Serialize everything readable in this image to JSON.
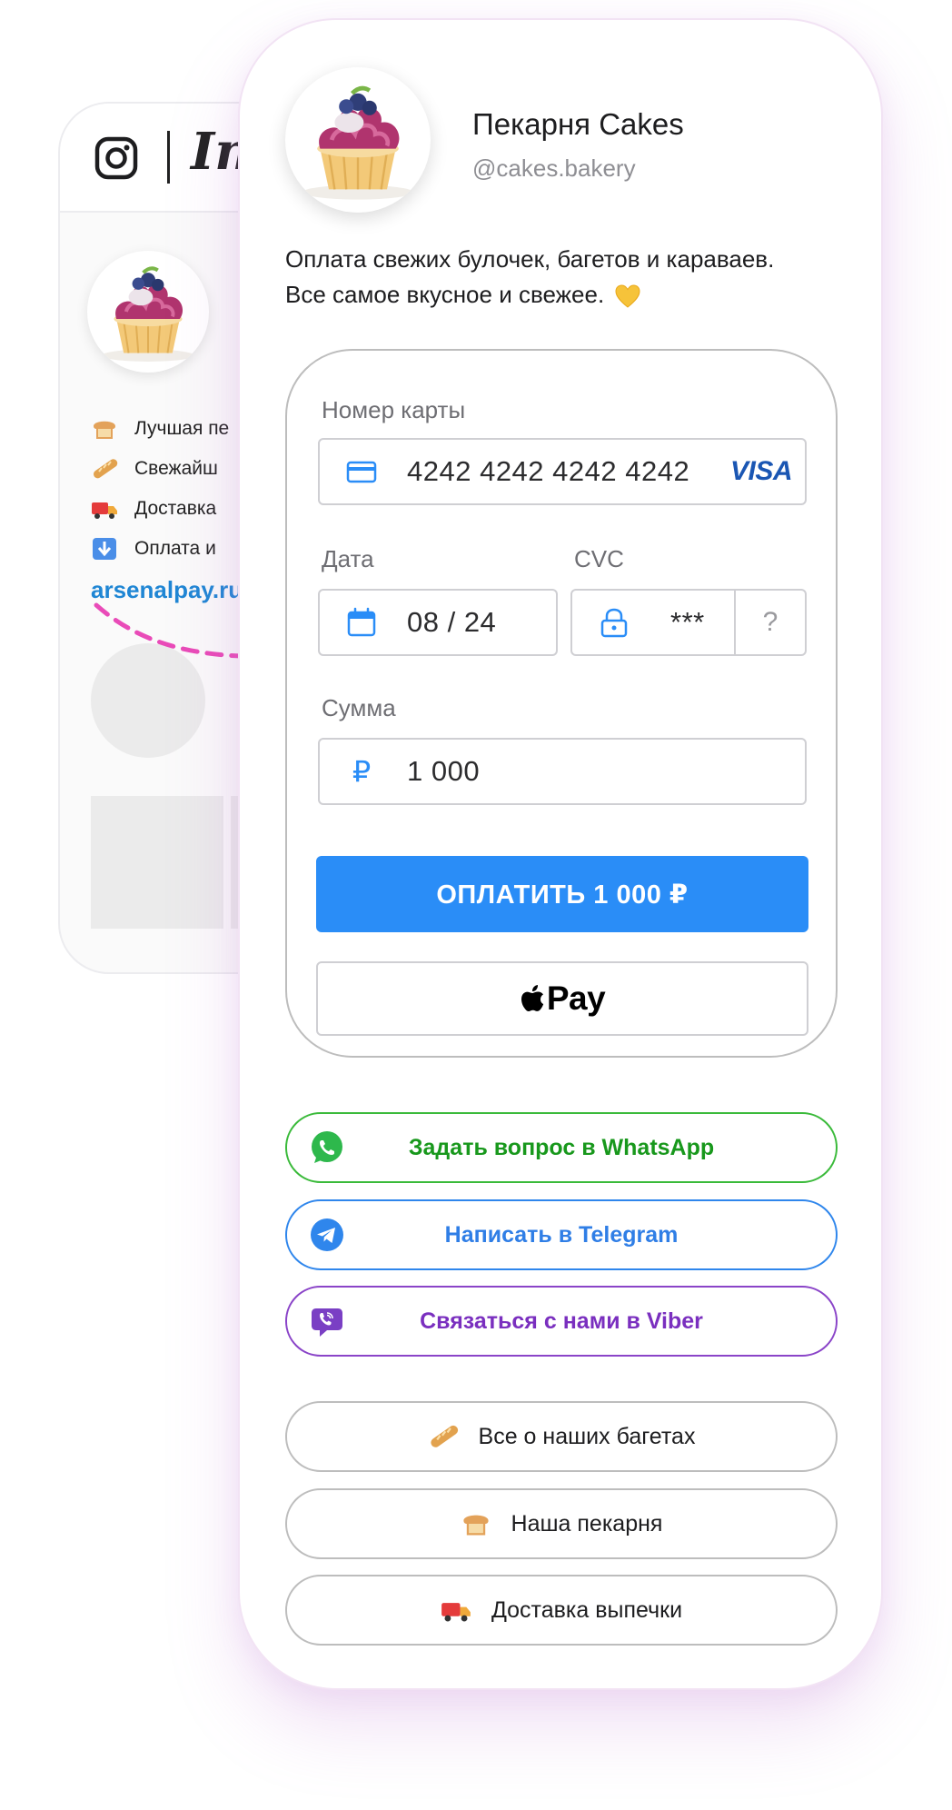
{
  "instagram_preview": {
    "wordmark": "In",
    "items": [
      {
        "icon": "bread-emoji",
        "text": "Лучшая пе"
      },
      {
        "icon": "baguette-emoji",
        "text": "Свежайш"
      },
      {
        "icon": "truck-emoji",
        "text": "Доставка"
      },
      {
        "icon": "down-arrow-emoji",
        "text": "Оплата и"
      }
    ],
    "link": "arsenalpay.ru"
  },
  "profile": {
    "name": "Пекарня Cakes",
    "handle": "@cakes.bakery",
    "description_line1": "Оплата свежих булочек, багетов и караваев.",
    "description_line2": "Все самое вкусное и свежее."
  },
  "payment": {
    "card_label": "Номер карты",
    "card_number": "4242 4242 4242 4242",
    "card_brand": "VISA",
    "date_label": "Дата",
    "date_value": "08 / 24",
    "cvc_label": "CVC",
    "cvc_value": "***",
    "cvc_help": "?",
    "amount_label": "Сумма",
    "currency_symbol": "₽",
    "amount_value": "1 000",
    "pay_button": "ОПЛАТИТЬ 1 000 ₽",
    "apple_pay_label": "Pay"
  },
  "messengers": [
    {
      "label": "Задать вопрос в WhatsApp",
      "color": "#18981c"
    },
    {
      "label": "Написать в Telegram",
      "color": "#2f7ee6"
    },
    {
      "label": "Связаться с нами в Viber",
      "color": "#7a2fbf"
    }
  ],
  "links": [
    {
      "icon": "baguette-emoji",
      "label": "Все о наших багетах"
    },
    {
      "icon": "bread-emoji",
      "label": "Наша пекарня"
    },
    {
      "icon": "truck-emoji",
      "label": "Доставка выпечки"
    }
  ],
  "colors": {
    "accent": "#2a8df7",
    "whatsapp": "#3aba3a",
    "telegram": "#2f86ec",
    "viber": "#8a44c8",
    "arrow": "#e94bb8",
    "link": "#1f86d4"
  }
}
